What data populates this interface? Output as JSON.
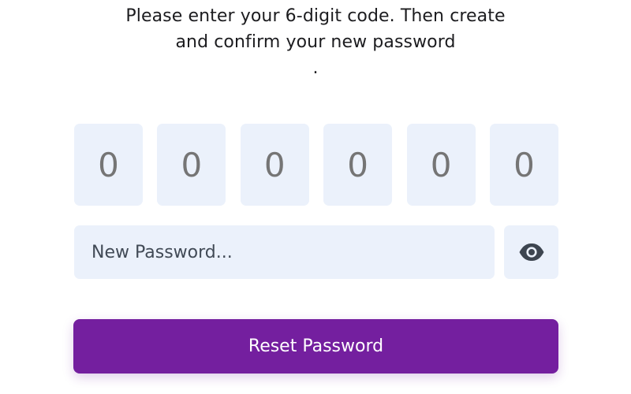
{
  "instructions": {
    "line1": "Please enter your 6-digit code. Then create",
    "line2": "and confirm your new password",
    "line3": "."
  },
  "code_inputs": [
    {
      "placeholder": "0",
      "value": ""
    },
    {
      "placeholder": "0",
      "value": ""
    },
    {
      "placeholder": "0",
      "value": ""
    },
    {
      "placeholder": "0",
      "value": ""
    },
    {
      "placeholder": "0",
      "value": ""
    },
    {
      "placeholder": "0",
      "value": ""
    }
  ],
  "password": {
    "placeholder": "New Password...",
    "value": "",
    "toggle_icon": "eye-icon"
  },
  "submit": {
    "label": "Reset Password"
  },
  "colors": {
    "accent": "#741f9f",
    "input_background": "#ebf1fb",
    "text": "#1c1c1f",
    "placeholder": "#6b7580",
    "icon": "#3d4550"
  }
}
